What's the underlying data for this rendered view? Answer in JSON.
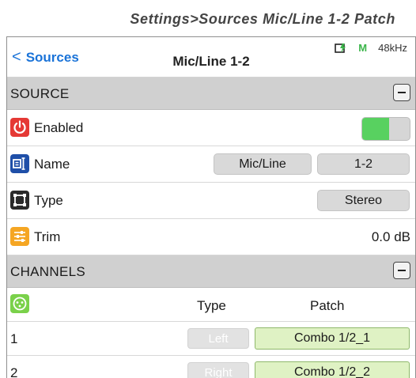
{
  "caption": "Settings>Sources Mic/Line 1-2 Patch",
  "navbar": {
    "back_label": "Sources",
    "back_chevron": "<",
    "title": "Mic/Line 1-2",
    "status": {
      "mode": "M",
      "sample_rate": "48kHz"
    }
  },
  "source_section": {
    "label": "SOURCE",
    "rows": {
      "enabled": {
        "label": "Enabled",
        "value": true,
        "icon": "power-icon",
        "icon_color": "#e53935"
      },
      "name": {
        "label": "Name",
        "part1": "Mic/Line",
        "part2": "1-2",
        "icon": "rename-icon",
        "icon_color": "#1f4fa8"
      },
      "type": {
        "label": "Type",
        "value": "Stereo",
        "icon": "type-frame-icon",
        "icon_color": "#2a2a2a"
      },
      "trim": {
        "label": "Trim",
        "value": "0.0 dB",
        "icon": "sliders-icon",
        "icon_color": "#f5a623"
      }
    }
  },
  "channels_section": {
    "label": "CHANNELS",
    "header": {
      "icon": "xlr-connector-icon",
      "icon_color": "#7ad14a",
      "type_col": "Type",
      "patch_col": "Patch"
    },
    "rows": [
      {
        "num": "1",
        "type": "Left",
        "patch": "Combo 1/2_1"
      },
      {
        "num": "2",
        "type": "Right",
        "patch": "Combo 1/2_2"
      }
    ]
  },
  "colors": {
    "accent": "#1a73d8",
    "toggle_on": "#58d160",
    "patch_fill": "#dff2c4",
    "section_bg": "#d0d0d0"
  }
}
